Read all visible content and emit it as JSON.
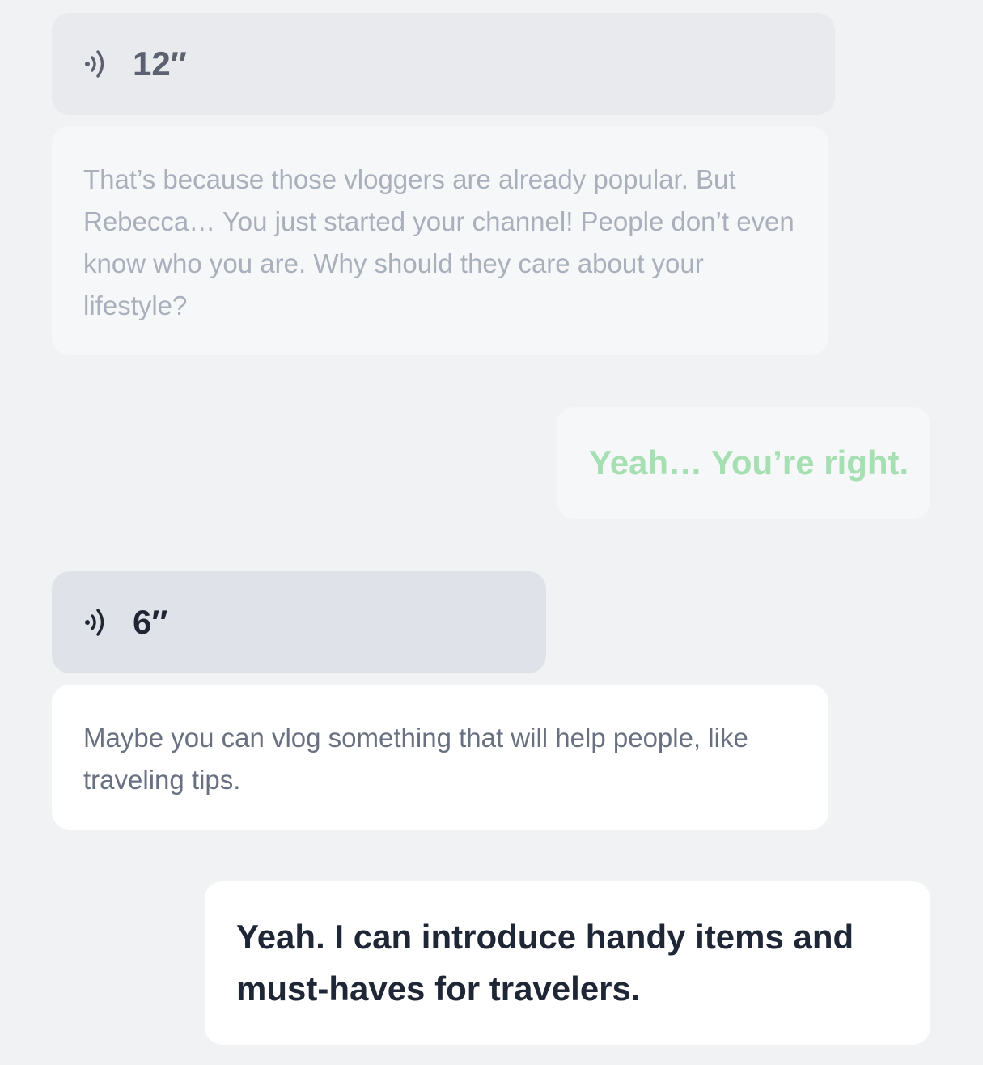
{
  "messages": [
    {
      "audio_duration": "12″",
      "icon": "speaker-icon",
      "text": "That’s because those vloggers are already popular. But Rebecca… You just started your channel! People don’t even know who you are. Why should they care about your lifestyle?"
    },
    {
      "audio_duration": "6″",
      "icon": "speaker-icon",
      "text": "Maybe you can vlog something that will help people, like traveling tips."
    }
  ],
  "replies": [
    {
      "text": "Yeah… You’re right."
    },
    {
      "text": "Yeah. I can introduce handy items and must-haves for travelers."
    }
  ],
  "colors": {
    "background": "#f1f2f4",
    "reply_green": "#a6dfb2",
    "dark_text": "#1f2636"
  }
}
